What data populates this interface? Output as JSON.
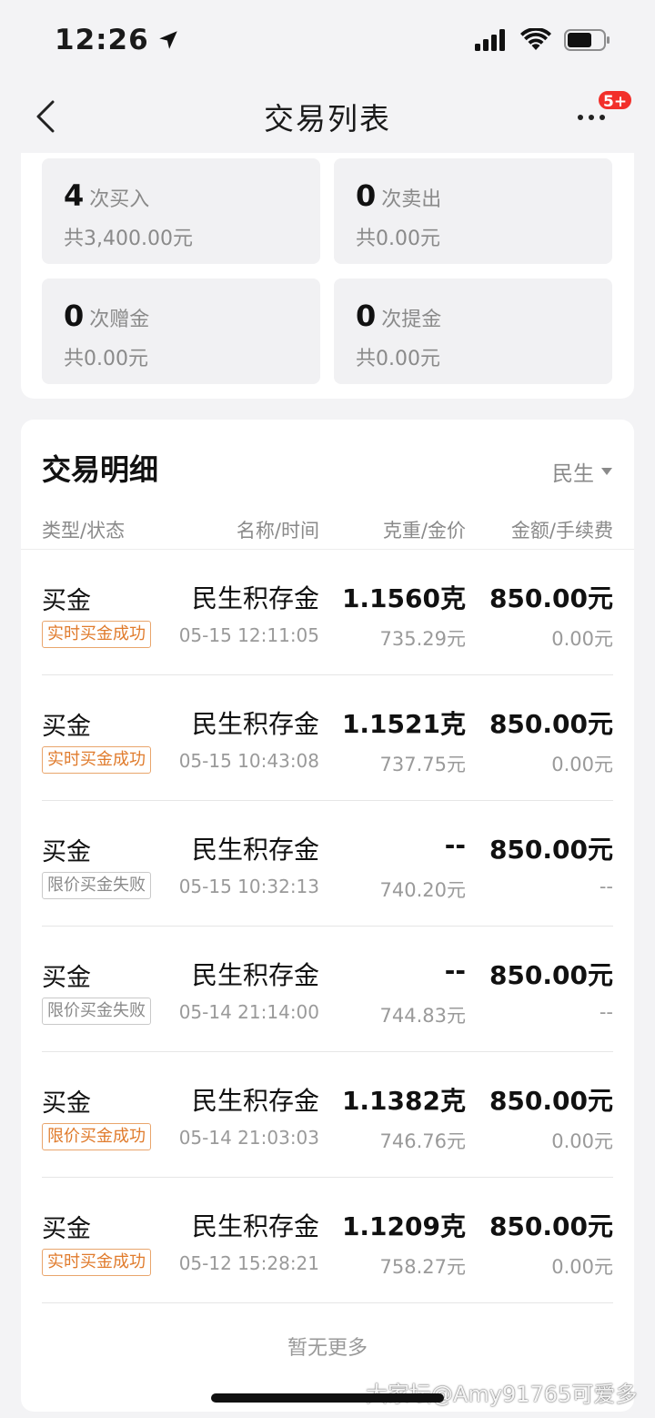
{
  "status_bar": {
    "time": "12:26"
  },
  "nav": {
    "title": "交易列表",
    "badge": "5+"
  },
  "summary": [
    {
      "count": "4",
      "label": "次买入",
      "total": "共3,400.00元"
    },
    {
      "count": "0",
      "label": "次卖出",
      "total": "共0.00元"
    },
    {
      "count": "0",
      "label": "次赠金",
      "total": "共0.00元"
    },
    {
      "count": "0",
      "label": "次提金",
      "total": "共0.00元"
    }
  ],
  "detail": {
    "title": "交易明细",
    "filter": "民生",
    "columns": [
      "类型/状态",
      "名称/时间",
      "克重/金价",
      "金额/手续费"
    ],
    "rows": [
      {
        "type": "买金",
        "status": "实时买金成功",
        "name": "民生积存金",
        "time": "05-15 12:11:05",
        "weight": "1.1560克",
        "price": "735.29元",
        "amount": "850.00元",
        "fee": "0.00元"
      },
      {
        "type": "买金",
        "status": "实时买金成功",
        "name": "民生积存金",
        "time": "05-15 10:43:08",
        "weight": "1.1521克",
        "price": "737.75元",
        "amount": "850.00元",
        "fee": "0.00元"
      },
      {
        "type": "买金",
        "status": "限价买金失败",
        "name": "民生积存金",
        "time": "05-15 10:32:13",
        "weight": "--",
        "price": "740.20元",
        "amount": "850.00元",
        "fee": "--"
      },
      {
        "type": "买金",
        "status": "限价买金失败",
        "name": "民生积存金",
        "time": "05-14 21:14:00",
        "weight": "--",
        "price": "744.83元",
        "amount": "850.00元",
        "fee": "--"
      },
      {
        "type": "买金",
        "status": "限价买金成功",
        "name": "民生积存金",
        "time": "05-14 21:03:03",
        "weight": "1.1382克",
        "price": "746.76元",
        "amount": "850.00元",
        "fee": "0.00元"
      },
      {
        "type": "买金",
        "status": "实时买金成功",
        "name": "民生积存金",
        "time": "05-12 15:28:21",
        "weight": "1.1209克",
        "price": "758.27元",
        "amount": "850.00元",
        "fee": "0.00元"
      }
    ],
    "footer": "暂无更多"
  },
  "watermark": "大家坛@Amy91765可爱多",
  "colors": {
    "success": "#e07b2c",
    "fail": "#8a8a8a",
    "badge": "#f2302b"
  },
  "icons": [
    "location-arrow-icon",
    "signal-icon",
    "wifi-icon",
    "battery-icon",
    "back-chevron-icon",
    "more-icon",
    "dropdown-triangle-icon"
  ]
}
